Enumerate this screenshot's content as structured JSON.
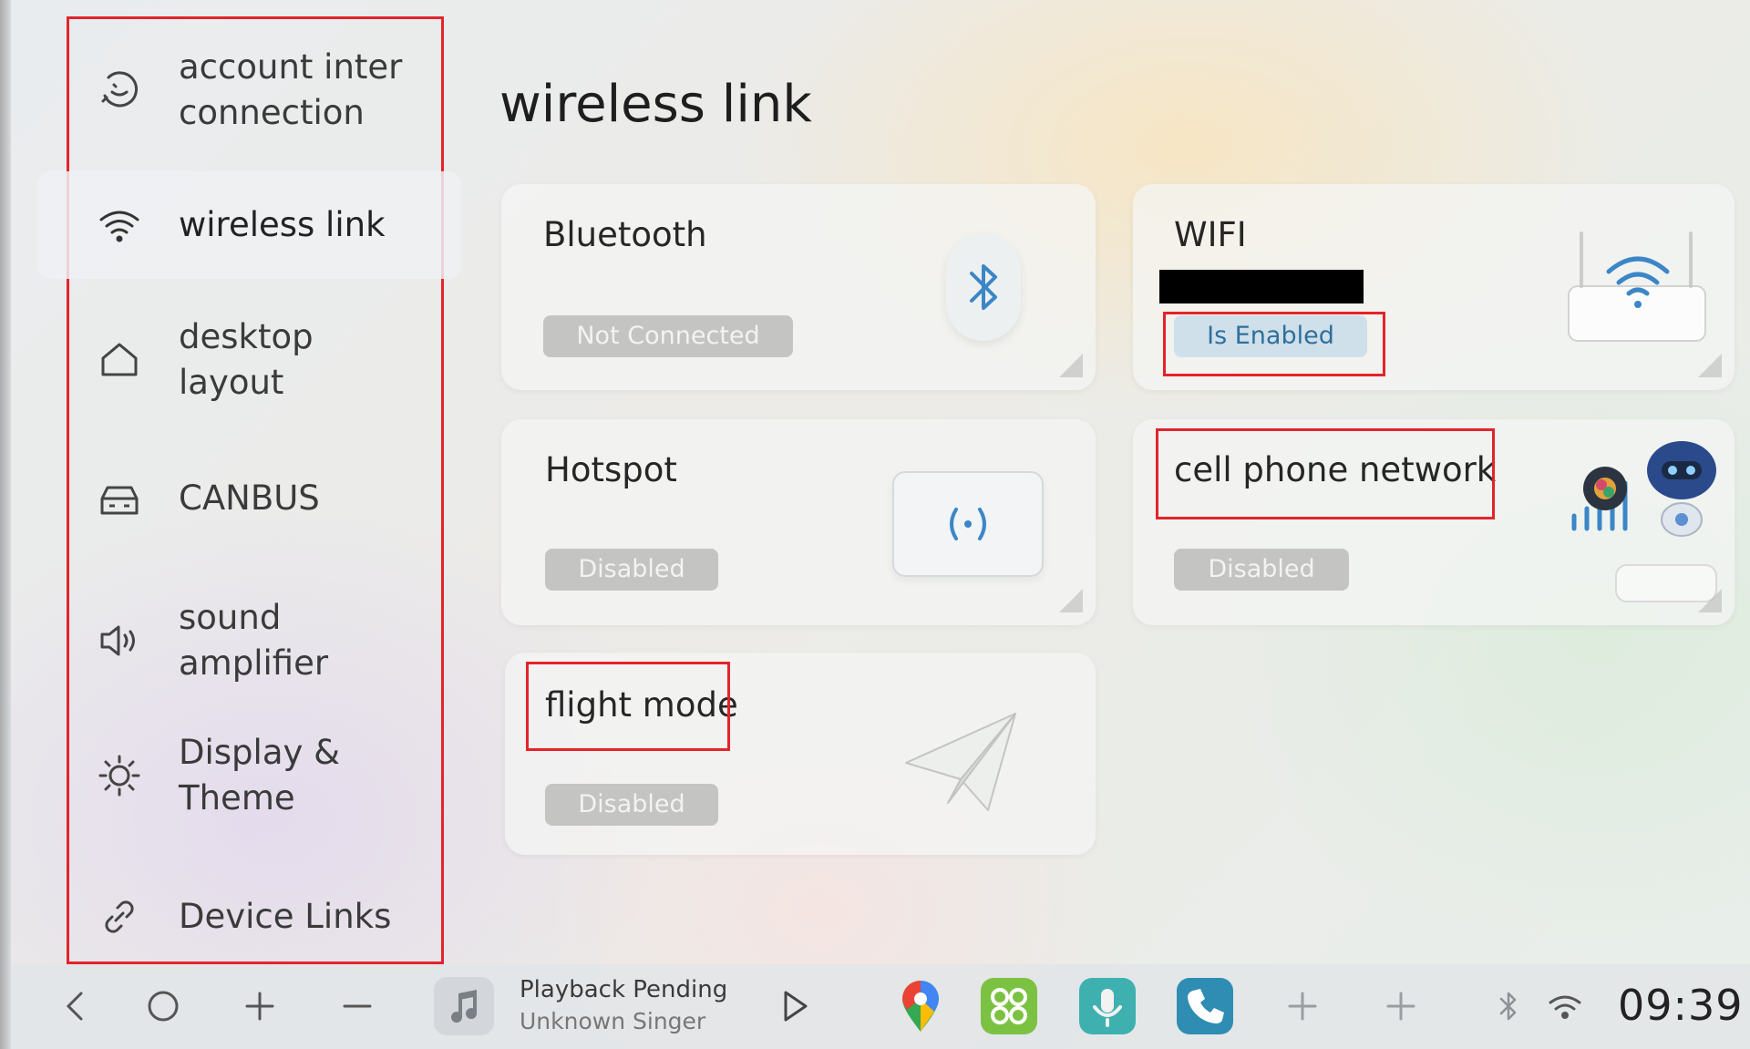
{
  "sidebar": {
    "items": [
      {
        "label": "account inter\nconnection",
        "icon": "account-link-icon"
      },
      {
        "label": "wireless link",
        "icon": "wifi-icon",
        "active": true
      },
      {
        "label": "desktop\nlayout",
        "icon": "home-icon"
      },
      {
        "label": "CANBUS",
        "icon": "car-icon"
      },
      {
        "label": "sound\namplifier",
        "icon": "speaker-icon"
      },
      {
        "label": "Display &\nTheme",
        "icon": "brightness-icon"
      },
      {
        "label": "Device Links",
        "icon": "link-icon"
      }
    ]
  },
  "main": {
    "title": "wireless link",
    "cards": {
      "bluetooth": {
        "title": "Bluetooth",
        "status": "Not Connected",
        "icon": "bluetooth-icon"
      },
      "wifi": {
        "title": "WIFI",
        "status": "Is Enabled",
        "icon": "router-wifi-icon"
      },
      "hotspot": {
        "title": "Hotspot",
        "status": "Disabled",
        "icon": "hotspot-icon"
      },
      "cellular": {
        "title": "cell phone network",
        "status": "Disabled",
        "icon": "robot-signal-icon"
      },
      "flight": {
        "title": "flight mode",
        "status": "Disabled",
        "icon": "paper-plane-icon"
      }
    }
  },
  "taskbar": {
    "media": {
      "title": "Playback Pending",
      "artist": "Unknown Singer"
    },
    "clock": "09:39",
    "icons": [
      "back-icon",
      "home-circle-icon",
      "volume-up-icon",
      "volume-down-icon",
      "music-note-icon",
      "play-icon",
      "maps-icon",
      "apps-grid-icon",
      "voice-assistant-icon",
      "phone-icon",
      "add-icon",
      "add-icon",
      "bluetooth-status-icon",
      "wifi-status-icon"
    ]
  },
  "colors": {
    "highlight": "#e3242b",
    "enabled_text": "#2f6f9c",
    "enabled_bg": "#cfe0ea",
    "disabled_bg": "#c4c4c2"
  }
}
